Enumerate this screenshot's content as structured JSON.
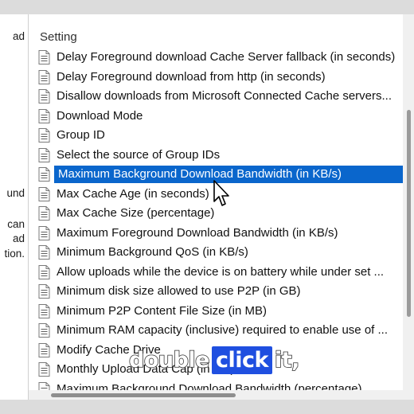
{
  "left_fragments": [
    "ad",
    "und",
    "can",
    "ad",
    "tion."
  ],
  "column_header": "Setting",
  "settings": [
    {
      "label": "Delay Foreground download Cache Server fallback (in seconds)",
      "selected": false
    },
    {
      "label": "Delay Foreground download from http (in seconds)",
      "selected": false
    },
    {
      "label": "Disallow downloads from Microsoft Connected Cache servers...",
      "selected": false
    },
    {
      "label": "Download Mode",
      "selected": false
    },
    {
      "label": "Group ID",
      "selected": false
    },
    {
      "label": "Select the source of Group IDs",
      "selected": false
    },
    {
      "label": "Maximum Background Download Bandwidth (in KB/s)",
      "selected": true
    },
    {
      "label": "Max Cache Age (in seconds)",
      "selected": false
    },
    {
      "label": "Max Cache Size (percentage)",
      "selected": false
    },
    {
      "label": "Maximum Foreground Download Bandwidth (in KB/s)",
      "selected": false
    },
    {
      "label": "Minimum Background QoS (in KB/s)",
      "selected": false
    },
    {
      "label": "Allow uploads while the device is on battery while under set ...",
      "selected": false
    },
    {
      "label": "Minimum disk size allowed to use P2P (in GB)",
      "selected": false
    },
    {
      "label": "Minimum P2P Content File Size (in MB)",
      "selected": false
    },
    {
      "label": "Minimum RAM capacity (inclusive) required to enable use of ...",
      "selected": false
    },
    {
      "label": "Modify Cache Drive",
      "selected": false
    },
    {
      "label": "Monthly Upload Data Cap (in GB)",
      "selected": false
    },
    {
      "label": "Maximum Background Download Bandwidth (percentage)",
      "selected": false
    }
  ],
  "icon": "setting-document-icon",
  "caption": {
    "before": "double",
    "highlight": "click",
    "after": "it,"
  },
  "colors": {
    "selection": "#0a66cc",
    "caption_highlight": "#1f4fe0"
  }
}
